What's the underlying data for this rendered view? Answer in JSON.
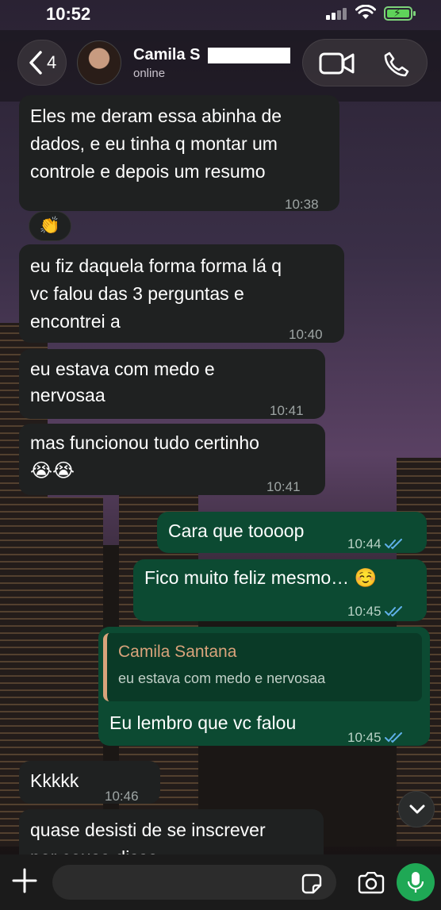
{
  "status_bar": {
    "time": "10:52"
  },
  "header": {
    "back_count": "4",
    "contact_name": "Camila S",
    "contact_status": "online"
  },
  "messages": [
    {
      "dir": "in",
      "lines": [
        "Eles me deram essa abinha de",
        "dados, e eu tinha q montar um",
        "controle e depois um resumo"
      ],
      "time": "10:38"
    },
    {
      "dir": "in",
      "lines": [
        "eu fiz daquela forma forma lá q",
        "vc falou das 3 perguntas e",
        "encontrei a"
      ],
      "time": "10:40"
    },
    {
      "dir": "in",
      "lines": [
        "eu estava com medo e",
        "nervosaa"
      ],
      "time": "10:41"
    },
    {
      "dir": "in",
      "lines": [
        "mas funcionou tudo certinho",
        "😭😭"
      ],
      "time": "10:41"
    },
    {
      "dir": "out",
      "lines": [
        "Cara que toooop"
      ],
      "time": "10:44"
    },
    {
      "dir": "out",
      "lines": [
        "Fico muito feliz mesmo… ☺️"
      ],
      "time": "10:45"
    },
    {
      "dir": "out",
      "lines": [
        "Eu lembro que vc falou"
      ],
      "time": "10:45",
      "quote": {
        "name": "Camila Santana",
        "text": "eu estava com medo e nervosaa"
      }
    },
    {
      "dir": "in",
      "lines": [
        "Kkkkk"
      ],
      "time": "10:46"
    },
    {
      "dir": "in",
      "lines": [
        "quase desisti de se inscrever",
        "por causa disso"
      ],
      "time": ""
    }
  ],
  "reaction": "👏",
  "composer": {
    "placeholder": ""
  },
  "colors": {
    "incoming_bubble": "#1f2121",
    "outgoing_bubble": "#0c4a32",
    "quote_accent": "#d9a37b",
    "read_ticks": "#5fb0e8",
    "mic_button": "#1fa855"
  },
  "icons": [
    "back-chevron-icon",
    "video-call-icon",
    "phone-call-icon",
    "clapping-hands-icon",
    "read-receipt-icon",
    "scroll-down-chevron-icon",
    "plus-icon",
    "sticker-icon",
    "camera-icon",
    "microphone-icon"
  ]
}
